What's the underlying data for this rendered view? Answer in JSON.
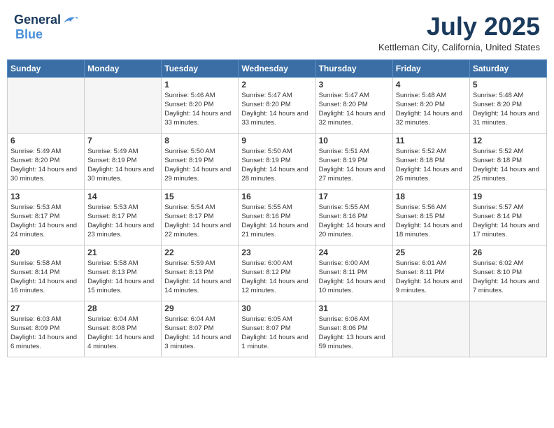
{
  "header": {
    "logo_general": "General",
    "logo_blue": "Blue",
    "month_year": "July 2025",
    "location": "Kettleman City, California, United States"
  },
  "weekdays": [
    "Sunday",
    "Monday",
    "Tuesday",
    "Wednesday",
    "Thursday",
    "Friday",
    "Saturday"
  ],
  "weeks": [
    [
      {
        "day": "",
        "empty": true
      },
      {
        "day": "",
        "empty": true
      },
      {
        "day": "1",
        "sunrise": "Sunrise: 5:46 AM",
        "sunset": "Sunset: 8:20 PM",
        "daylight": "Daylight: 14 hours and 33 minutes."
      },
      {
        "day": "2",
        "sunrise": "Sunrise: 5:47 AM",
        "sunset": "Sunset: 8:20 PM",
        "daylight": "Daylight: 14 hours and 33 minutes."
      },
      {
        "day": "3",
        "sunrise": "Sunrise: 5:47 AM",
        "sunset": "Sunset: 8:20 PM",
        "daylight": "Daylight: 14 hours and 32 minutes."
      },
      {
        "day": "4",
        "sunrise": "Sunrise: 5:48 AM",
        "sunset": "Sunset: 8:20 PM",
        "daylight": "Daylight: 14 hours and 32 minutes."
      },
      {
        "day": "5",
        "sunrise": "Sunrise: 5:48 AM",
        "sunset": "Sunset: 8:20 PM",
        "daylight": "Daylight: 14 hours and 31 minutes."
      }
    ],
    [
      {
        "day": "6",
        "sunrise": "Sunrise: 5:49 AM",
        "sunset": "Sunset: 8:20 PM",
        "daylight": "Daylight: 14 hours and 30 minutes."
      },
      {
        "day": "7",
        "sunrise": "Sunrise: 5:49 AM",
        "sunset": "Sunset: 8:19 PM",
        "daylight": "Daylight: 14 hours and 30 minutes."
      },
      {
        "day": "8",
        "sunrise": "Sunrise: 5:50 AM",
        "sunset": "Sunset: 8:19 PM",
        "daylight": "Daylight: 14 hours and 29 minutes."
      },
      {
        "day": "9",
        "sunrise": "Sunrise: 5:50 AM",
        "sunset": "Sunset: 8:19 PM",
        "daylight": "Daylight: 14 hours and 28 minutes."
      },
      {
        "day": "10",
        "sunrise": "Sunrise: 5:51 AM",
        "sunset": "Sunset: 8:19 PM",
        "daylight": "Daylight: 14 hours and 27 minutes."
      },
      {
        "day": "11",
        "sunrise": "Sunrise: 5:52 AM",
        "sunset": "Sunset: 8:18 PM",
        "daylight": "Daylight: 14 hours and 26 minutes."
      },
      {
        "day": "12",
        "sunrise": "Sunrise: 5:52 AM",
        "sunset": "Sunset: 8:18 PM",
        "daylight": "Daylight: 14 hours and 25 minutes."
      }
    ],
    [
      {
        "day": "13",
        "sunrise": "Sunrise: 5:53 AM",
        "sunset": "Sunset: 8:17 PM",
        "daylight": "Daylight: 14 hours and 24 minutes."
      },
      {
        "day": "14",
        "sunrise": "Sunrise: 5:53 AM",
        "sunset": "Sunset: 8:17 PM",
        "daylight": "Daylight: 14 hours and 23 minutes."
      },
      {
        "day": "15",
        "sunrise": "Sunrise: 5:54 AM",
        "sunset": "Sunset: 8:17 PM",
        "daylight": "Daylight: 14 hours and 22 minutes."
      },
      {
        "day": "16",
        "sunrise": "Sunrise: 5:55 AM",
        "sunset": "Sunset: 8:16 PM",
        "daylight": "Daylight: 14 hours and 21 minutes."
      },
      {
        "day": "17",
        "sunrise": "Sunrise: 5:55 AM",
        "sunset": "Sunset: 8:16 PM",
        "daylight": "Daylight: 14 hours and 20 minutes."
      },
      {
        "day": "18",
        "sunrise": "Sunrise: 5:56 AM",
        "sunset": "Sunset: 8:15 PM",
        "daylight": "Daylight: 14 hours and 18 minutes."
      },
      {
        "day": "19",
        "sunrise": "Sunrise: 5:57 AM",
        "sunset": "Sunset: 8:14 PM",
        "daylight": "Daylight: 14 hours and 17 minutes."
      }
    ],
    [
      {
        "day": "20",
        "sunrise": "Sunrise: 5:58 AM",
        "sunset": "Sunset: 8:14 PM",
        "daylight": "Daylight: 14 hours and 16 minutes."
      },
      {
        "day": "21",
        "sunrise": "Sunrise: 5:58 AM",
        "sunset": "Sunset: 8:13 PM",
        "daylight": "Daylight: 14 hours and 15 minutes."
      },
      {
        "day": "22",
        "sunrise": "Sunrise: 5:59 AM",
        "sunset": "Sunset: 8:13 PM",
        "daylight": "Daylight: 14 hours and 14 minutes."
      },
      {
        "day": "23",
        "sunrise": "Sunrise: 6:00 AM",
        "sunset": "Sunset: 8:12 PM",
        "daylight": "Daylight: 14 hours and 12 minutes."
      },
      {
        "day": "24",
        "sunrise": "Sunrise: 6:00 AM",
        "sunset": "Sunset: 8:11 PM",
        "daylight": "Daylight: 14 hours and 10 minutes."
      },
      {
        "day": "25",
        "sunrise": "Sunrise: 6:01 AM",
        "sunset": "Sunset: 8:11 PM",
        "daylight": "Daylight: 14 hours and 9 minutes."
      },
      {
        "day": "26",
        "sunrise": "Sunrise: 6:02 AM",
        "sunset": "Sunset: 8:10 PM",
        "daylight": "Daylight: 14 hours and 7 minutes."
      }
    ],
    [
      {
        "day": "27",
        "sunrise": "Sunrise: 6:03 AM",
        "sunset": "Sunset: 8:09 PM",
        "daylight": "Daylight: 14 hours and 6 minutes."
      },
      {
        "day": "28",
        "sunrise": "Sunrise: 6:04 AM",
        "sunset": "Sunset: 8:08 PM",
        "daylight": "Daylight: 14 hours and 4 minutes."
      },
      {
        "day": "29",
        "sunrise": "Sunrise: 6:04 AM",
        "sunset": "Sunset: 8:07 PM",
        "daylight": "Daylight: 14 hours and 3 minutes."
      },
      {
        "day": "30",
        "sunrise": "Sunrise: 6:05 AM",
        "sunset": "Sunset: 8:07 PM",
        "daylight": "Daylight: 14 hours and 1 minute."
      },
      {
        "day": "31",
        "sunrise": "Sunrise: 6:06 AM",
        "sunset": "Sunset: 8:06 PM",
        "daylight": "Daylight: 13 hours and 59 minutes."
      },
      {
        "day": "",
        "empty": true
      },
      {
        "day": "",
        "empty": true
      }
    ]
  ]
}
